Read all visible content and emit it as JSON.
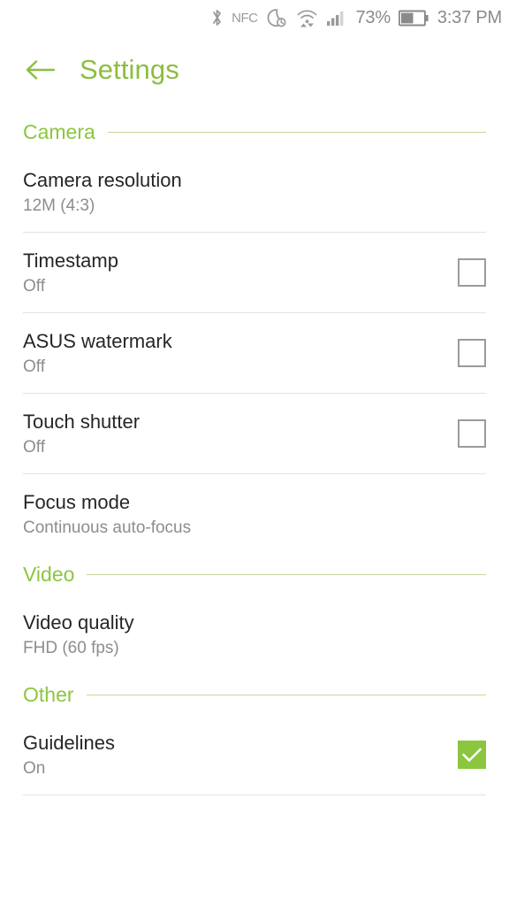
{
  "status_bar": {
    "bluetooth_icon": "bluetooth-icon",
    "nfc_label": "NFC",
    "dnd_icon": "do-not-disturb-moon-alarm-icon",
    "wifi_icon": "wifi-data-transfer-icon",
    "signal_icon": "cellular-signal-icon",
    "battery_percent": "73%",
    "battery_icon": "battery-icon",
    "clock": "3:37 PM"
  },
  "app_bar": {
    "back_icon": "back-arrow-icon",
    "title": "Settings"
  },
  "sections": [
    {
      "label": "Camera",
      "rows": [
        {
          "title": "Camera resolution",
          "sub": "12M (4:3)",
          "control": "none"
        },
        {
          "title": "Timestamp",
          "sub": "Off",
          "control": "checkbox",
          "checked": false
        },
        {
          "title": "ASUS watermark",
          "sub": "Off",
          "control": "checkbox",
          "checked": false
        },
        {
          "title": "Touch shutter",
          "sub": "Off",
          "control": "checkbox",
          "checked": false
        },
        {
          "title": "Focus mode",
          "sub": "Continuous auto-focus",
          "control": "none"
        }
      ]
    },
    {
      "label": "Video",
      "rows": [
        {
          "title": "Video quality",
          "sub": "FHD (60 fps)",
          "control": "none"
        }
      ]
    },
    {
      "label": "Other",
      "rows": [
        {
          "title": "Guidelines",
          "sub": "On",
          "control": "checkbox",
          "checked": true
        }
      ]
    }
  ],
  "colors": {
    "accent_green": "#8cc63f",
    "title_green": "#8cbe3f",
    "section_rule": "#c5d89a",
    "divider": "#e2e2e2",
    "primary_text": "#262626",
    "secondary_text": "#8d8d8d",
    "status_icon": "#9a9a9a"
  }
}
